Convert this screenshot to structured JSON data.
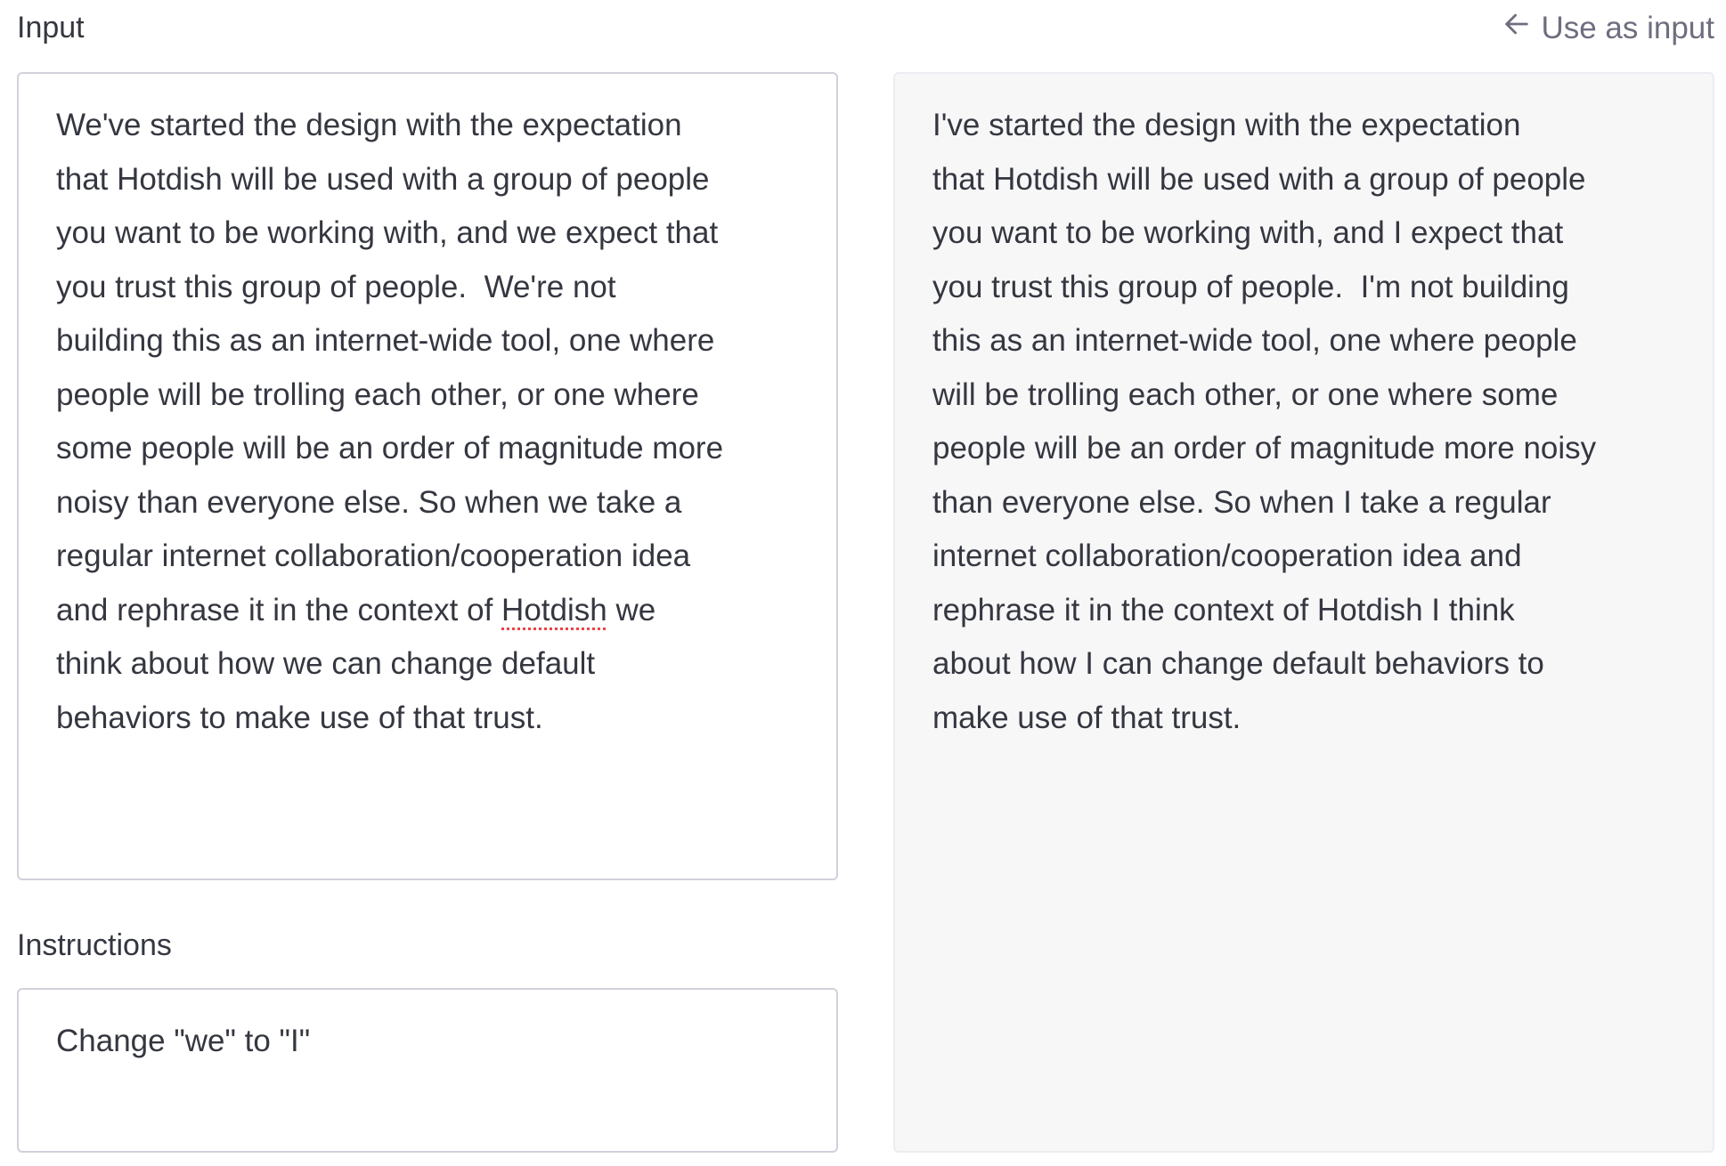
{
  "input": {
    "label": "Input",
    "lines": [
      "We've started the design with the expectation",
      "that Hotdish will be used with a group of people",
      "you want to be working with, and we expect that",
      "you trust this group of people.  We're not",
      "building this as an internet-wide tool, one where",
      "people will be trolling each other, or one where",
      "some people will be an order of magnitude more",
      "noisy than everyone else. So when we take a",
      "regular internet collaboration/cooperation idea"
    ],
    "line10": {
      "before": "and rephrase it in the context of ",
      "misspelled": "Hotdish",
      "after": " we"
    },
    "lines_end": [
      "think about how we can change default",
      "behaviors to make use of that trust."
    ]
  },
  "instructions": {
    "label": "Instructions",
    "value": "Change \"we\" to \"I\""
  },
  "output": {
    "use_as_input_label": "Use as input",
    "lines": [
      "I've started the design with the expectation",
      "that Hotdish will be used with a group of people",
      "you want to be working with, and I expect that",
      "you trust this group of people.  I'm not building",
      "this as an internet-wide tool, one where people",
      "will be trolling each other, or one where some",
      "people will be an order of magnitude more noisy",
      "than everyone else. So when I take a regular",
      "internet collaboration/cooperation idea and",
      "rephrase it in the context of Hotdish I think",
      "about how I can change default behaviors to",
      "make use of that trust."
    ]
  }
}
